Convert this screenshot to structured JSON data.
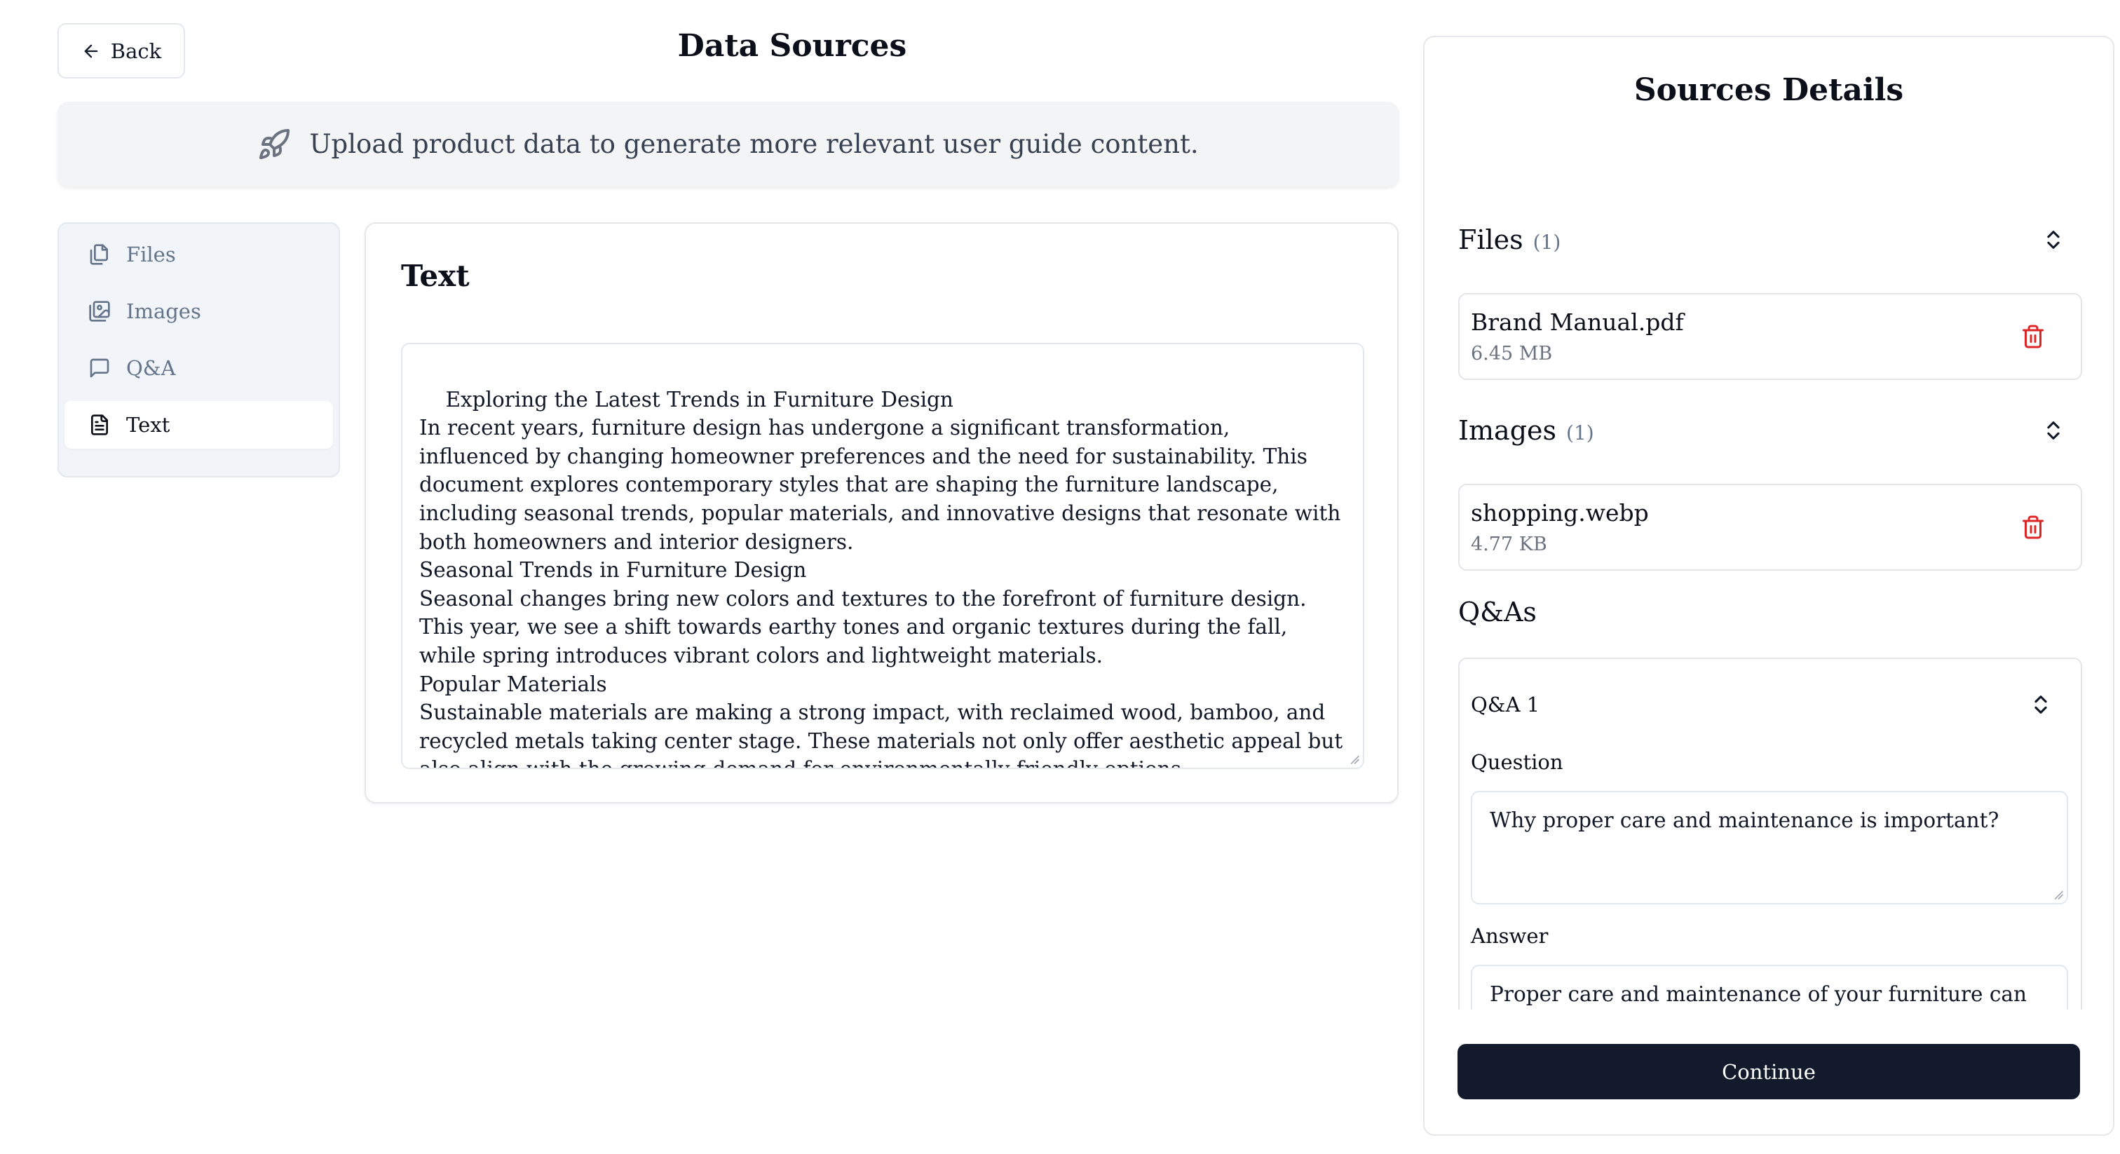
{
  "header": {
    "back_label": "Back",
    "title": "Data Sources"
  },
  "banner": {
    "icon": "rocket-icon",
    "text": "Upload product data to generate more relevant user guide content."
  },
  "sidebar": {
    "items": [
      {
        "label": "Files",
        "icon": "files-icon",
        "active": false
      },
      {
        "label": "Images",
        "icon": "images-icon",
        "active": false
      },
      {
        "label": "Q&A",
        "icon": "message-square-icon",
        "active": false
      },
      {
        "label": "Text",
        "icon": "file-text-icon",
        "active": true
      }
    ]
  },
  "text_panel": {
    "title": "Text",
    "content": "Exploring the Latest Trends in Furniture Design\nIn recent years, furniture design has undergone a significant transformation, influenced by changing homeowner preferences and the need for sustainability. This document explores contemporary styles that are shaping the furniture landscape, including seasonal trends, popular materials, and innovative designs that resonate with both homeowners and interior designers.\nSeasonal Trends in Furniture Design\nSeasonal changes bring new colors and textures to the forefront of furniture design. This year, we see a shift towards earthy tones and organic textures during the fall, while spring introduces vibrant colors and lightweight materials.\nPopular Materials\nSustainable materials are making a strong impact, with reclaimed wood, bamboo, and recycled metals taking center stage. These materials not only offer aesthetic appeal but also align with the growing demand for environmentally friendly options.\nInnovative Designs that Resonate\nDesigners are pushing boundaries with multifunctional furniture that maximizes small spaces"
  },
  "details": {
    "title": "Sources Details",
    "files": {
      "label": "Files",
      "count": "(1)",
      "items": [
        {
          "name": "Brand Manual.pdf",
          "size": "6.45 MB"
        }
      ]
    },
    "images": {
      "label": "Images",
      "count": "(1)",
      "items": [
        {
          "name": "shopping.webp",
          "size": "4.77 KB"
        }
      ]
    },
    "qas": {
      "label": "Q&As",
      "items": [
        {
          "title": "Q&A 1",
          "question_label": "Question",
          "question": "Why proper care and maintenance is important?",
          "answer_label": "Answer",
          "answer": "Proper care and maintenance of your furniture can significantly enhance its lifespan and appearance. This guide provides essential instructions for caring for various"
        }
      ]
    },
    "continue_label": "Continue"
  },
  "colors": {
    "primary_button": "#121a2b",
    "delete": "#dc2626",
    "muted_text": "#64748b",
    "banner_bg": "#f3f4f6",
    "sidebar_bg": "#f1f5f9"
  }
}
